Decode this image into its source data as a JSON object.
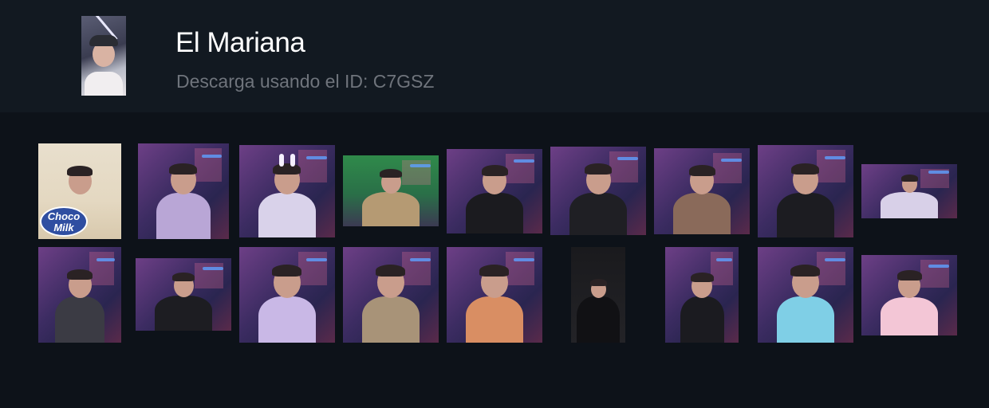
{
  "profile": {
    "name": "El Mariana",
    "download_text": "Descarga usando el ID: C7GSZ"
  },
  "gallery": {
    "images": [
      {
        "type": "choco",
        "badge_top": "Choco",
        "badge_bottom": "Milk"
      },
      {
        "type": "stream",
        "shirt": "#b9a6d6"
      },
      {
        "type": "stream",
        "shirt": "#d9d2ea",
        "bunny": true
      },
      {
        "type": "green",
        "shirt": "#b59a73"
      },
      {
        "type": "stream",
        "shirt": "#1b1b1f"
      },
      {
        "type": "stream",
        "shirt": "#1f1f24"
      },
      {
        "type": "stream",
        "shirt": "#8a6a5a"
      },
      {
        "type": "stream",
        "shirt": "#1c1c21"
      },
      {
        "type": "wide",
        "shirt": "#d8d0e8"
      },
      {
        "type": "stream",
        "shirt": "#3b3b44"
      },
      {
        "type": "stream",
        "shirt": "#1d1d22"
      },
      {
        "type": "stream",
        "shirt": "#c9b8e6"
      },
      {
        "type": "stream",
        "shirt": "#a89378"
      },
      {
        "type": "stream",
        "shirt": "#d98e63"
      },
      {
        "type": "suit",
        "shirt": "#111114"
      },
      {
        "type": "stream",
        "shirt": "#1b1b20"
      },
      {
        "type": "stream",
        "shirt": "#7fcfe6"
      },
      {
        "type": "stream",
        "shirt": "#f3c6d6"
      }
    ]
  }
}
